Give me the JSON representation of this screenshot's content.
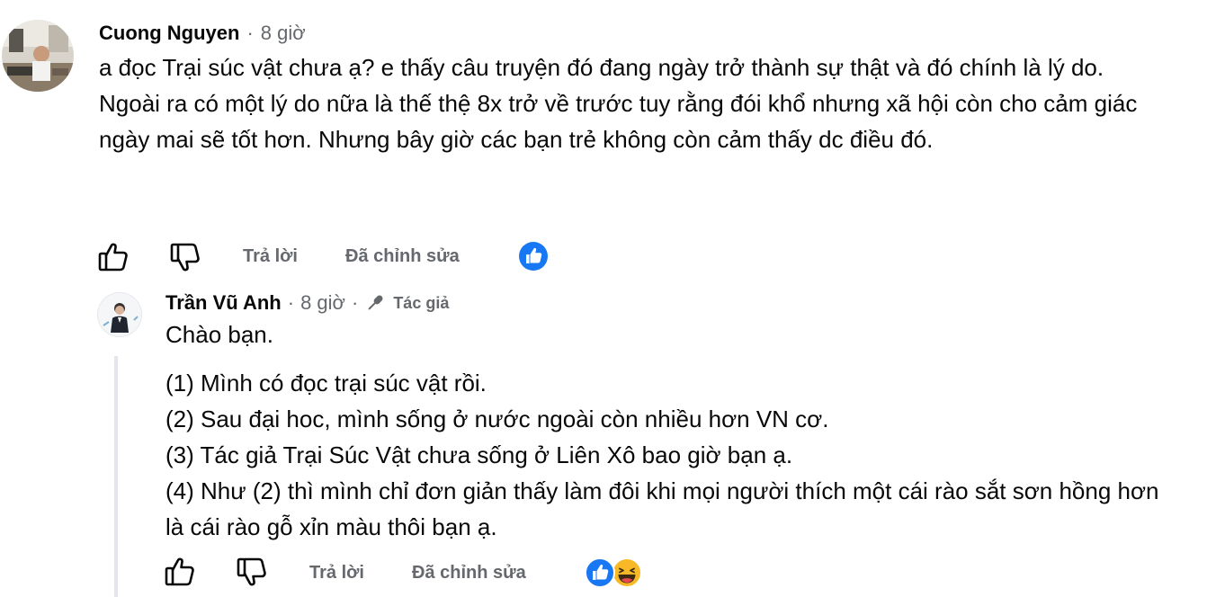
{
  "comment": {
    "author": "Cuong Nguyen",
    "time": "8 giờ",
    "paragraphs": [
      "a đọc Trại súc vật chưa ạ? e thấy câu truyện đó đang ngày trở thành sự thật và đó chính là lý do.",
      "Ngoài ra có một lý do nữa là thế thệ 8x trở về trước tuy rằng đói khổ nhưng xã hội còn cho cảm giác ngày mai sẽ tốt hơn. Nhưng bây giờ các bạn trẻ không còn cảm thấy dc điều đó."
    ],
    "actions": {
      "reply": "Trả lời",
      "edited": "Đã chỉnh sửa"
    },
    "reactions": [
      "like"
    ]
  },
  "reply": {
    "author": "Trần Vũ Anh",
    "time": "8 giờ",
    "author_badge": "Tác giả",
    "greeting": "Chào bạn.",
    "lines": [
      "(1) Mình có đọc trại súc vật rồi.",
      "(2) Sau đại hoc, mình sống ở nước ngoài còn nhiều hơn VN cơ.",
      "(3) Tác giả Trại Súc Vật chưa sống ở Liên Xô bao giờ bạn ạ.",
      "(4) Như (2) thì mình chỉ đơn giản thấy làm đôi khi mọi người thích một cái rào sắt sơn hồng hơn là cái rào gỗ xỉn màu thôi bạn ạ."
    ],
    "actions": {
      "reply": "Trả lời",
      "edited": "Đã chỉnh sửa"
    },
    "reactions": [
      "like",
      "haha"
    ]
  },
  "separator": "·",
  "colors": {
    "like_blue": "#1877f2",
    "meta_gray": "#65686c",
    "thread_line": "#e4e6eb",
    "haha_yellow": "#f7b928"
  }
}
